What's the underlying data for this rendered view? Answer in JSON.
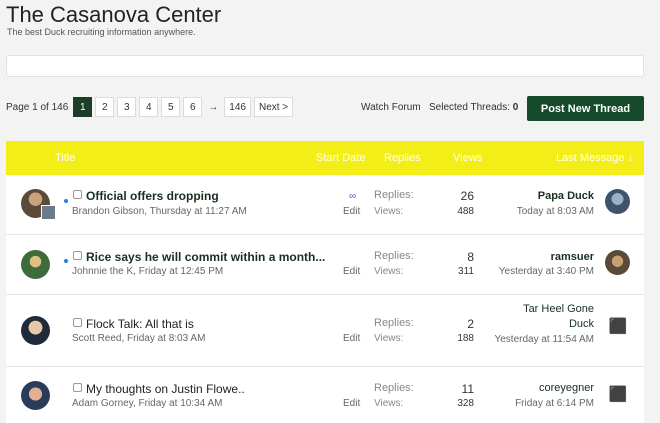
{
  "site": {
    "title": "The Casanova Center",
    "tagline": "The best Duck recruiting information anywhere."
  },
  "pager": {
    "label": "Page 1 of 146",
    "pages": [
      "1",
      "2",
      "3",
      "4",
      "5",
      "6"
    ],
    "arrow": "→",
    "last": "146",
    "next": "Next >"
  },
  "tools": {
    "watch_forum": "Watch Forum",
    "selected_label": "Selected Threads:",
    "selected_count": "0",
    "post_button": "Post New Thread"
  },
  "table": {
    "headers": {
      "title": "Title",
      "start_date": "Start Date",
      "replies": "Replies",
      "views": "Views",
      "last_message": "Last Message ↓"
    },
    "labels": {
      "replies": "Replies:",
      "views": "Views:",
      "edit": "Edit"
    },
    "threads": [
      {
        "title": "Official offers dropping",
        "author_meta": "Brandon Gibson, Thursday at 11:27 AM",
        "replies": "26",
        "views": "488",
        "last_user": "Papa Duck",
        "last_date": "Today at 8:03 AM"
      },
      {
        "title": "Rice says he will commit within a month...",
        "author_meta": "Johnnie the K, Friday at 12:45 PM",
        "replies": "8",
        "views": "311",
        "last_user": "ramsuer",
        "last_date": "Yesterday at 3:40 PM"
      },
      {
        "title": "Flock Talk: All that is",
        "author_meta": "Scott Reed, Friday at 8:03 AM",
        "replies": "2",
        "views": "188",
        "last_user_line1": "Tar Heel Gone",
        "last_user_line2": "Duck",
        "last_date": "Yesterday at 11:54 AM"
      },
      {
        "title": "My thoughts on Justin Flowe..",
        "author_meta": "Adam Gorney, Friday at 10:34 AM",
        "replies": "11",
        "views": "328",
        "last_user": "coreyegner",
        "last_date": "Friday at 6:14 PM"
      }
    ]
  }
}
